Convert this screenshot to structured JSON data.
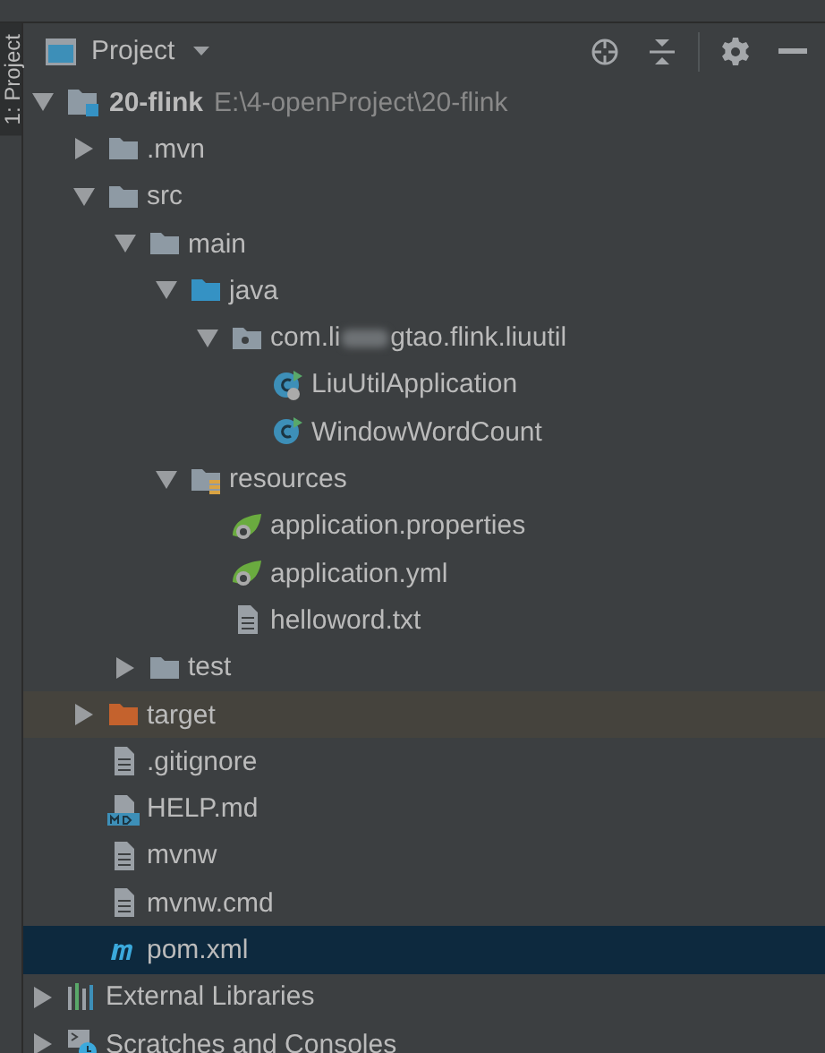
{
  "side_tab": {
    "label": "1: Project",
    "selected": true
  },
  "panel": {
    "title": "Project"
  },
  "tree": [
    {
      "kind": "project",
      "label": "20-flink",
      "path": "E:\\4-openProject\\20-flink",
      "expanded": true,
      "selected": false,
      "children": [
        {
          "kind": "folder",
          "label": ".mvn",
          "expanded": false,
          "selected": false
        },
        {
          "kind": "folder",
          "label": "src",
          "expanded": true,
          "selected": false,
          "children": [
            {
              "kind": "folder",
              "label": "main",
              "expanded": true,
              "selected": false,
              "children": [
                {
                  "kind": "source-folder",
                  "label": "java",
                  "expanded": true,
                  "selected": false,
                  "children": [
                    {
                      "kind": "package",
                      "label": "com.li",
                      "label_after_blur": "gtao.flink.liuutil",
                      "expanded": true,
                      "selected": false,
                      "children": [
                        {
                          "kind": "spring-class",
                          "label": "LiuUtilApplication",
                          "selected": false
                        },
                        {
                          "kind": "class",
                          "label": "WindowWordCount",
                          "selected": false
                        }
                      ]
                    }
                  ]
                },
                {
                  "kind": "resources-folder",
                  "label": "resources",
                  "expanded": true,
                  "selected": false,
                  "children": [
                    {
                      "kind": "spring-config",
                      "label": "application.properties",
                      "selected": false
                    },
                    {
                      "kind": "spring-config",
                      "label": "application.yml",
                      "selected": false
                    },
                    {
                      "kind": "text-file",
                      "label": "helloword.txt",
                      "selected": false
                    }
                  ]
                }
              ]
            },
            {
              "kind": "folder",
              "label": "test",
              "expanded": false,
              "selected": false
            }
          ]
        },
        {
          "kind": "excluded-folder",
          "label": "target",
          "expanded": false,
          "selected": false
        },
        {
          "kind": "text-file",
          "label": ".gitignore",
          "selected": false
        },
        {
          "kind": "md-file",
          "label": "HELP.md",
          "selected": false
        },
        {
          "kind": "text-file",
          "label": "mvnw",
          "selected": false
        },
        {
          "kind": "text-file",
          "label": "mvnw.cmd",
          "selected": false
        },
        {
          "kind": "maven",
          "label": "pom.xml",
          "selected": true
        }
      ]
    },
    {
      "kind": "libraries",
      "label": "External Libraries",
      "expanded": false,
      "selected": false
    },
    {
      "kind": "scratches",
      "label": "Scratches and Consoles",
      "expanded": false,
      "selected": false
    }
  ]
}
